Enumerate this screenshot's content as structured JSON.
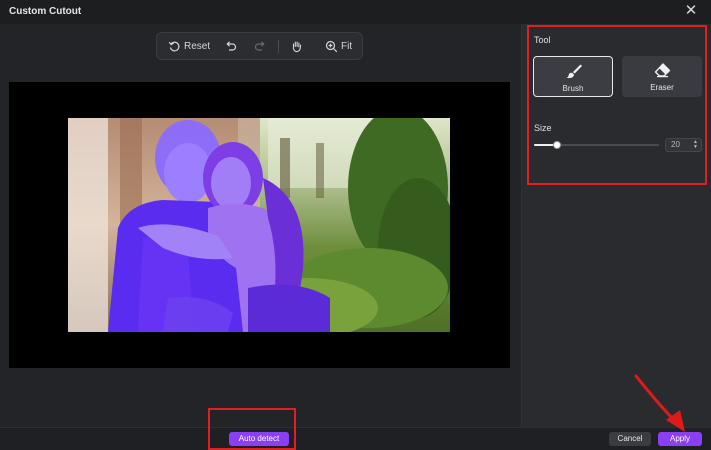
{
  "window": {
    "title": "Custom Cutout"
  },
  "toolbar": {
    "reset_label": "Reset",
    "fit_label": "Fit"
  },
  "panel": {
    "tool_heading": "Tool",
    "tools": [
      {
        "label": "Brush",
        "icon": "brush-icon",
        "active": true
      },
      {
        "label": "Eraser",
        "icon": "eraser-icon",
        "active": false
      }
    ],
    "size_heading": "Size",
    "size_value": "20",
    "size_slider_fraction": 0.18
  },
  "footer": {
    "auto_detect_label": "Auto detect",
    "cancel_label": "Cancel",
    "apply_label": "Apply"
  },
  "colors": {
    "accent": "#8b3ff2",
    "highlight_box": "#e02020",
    "mask_overlay": "#7a3cff"
  }
}
